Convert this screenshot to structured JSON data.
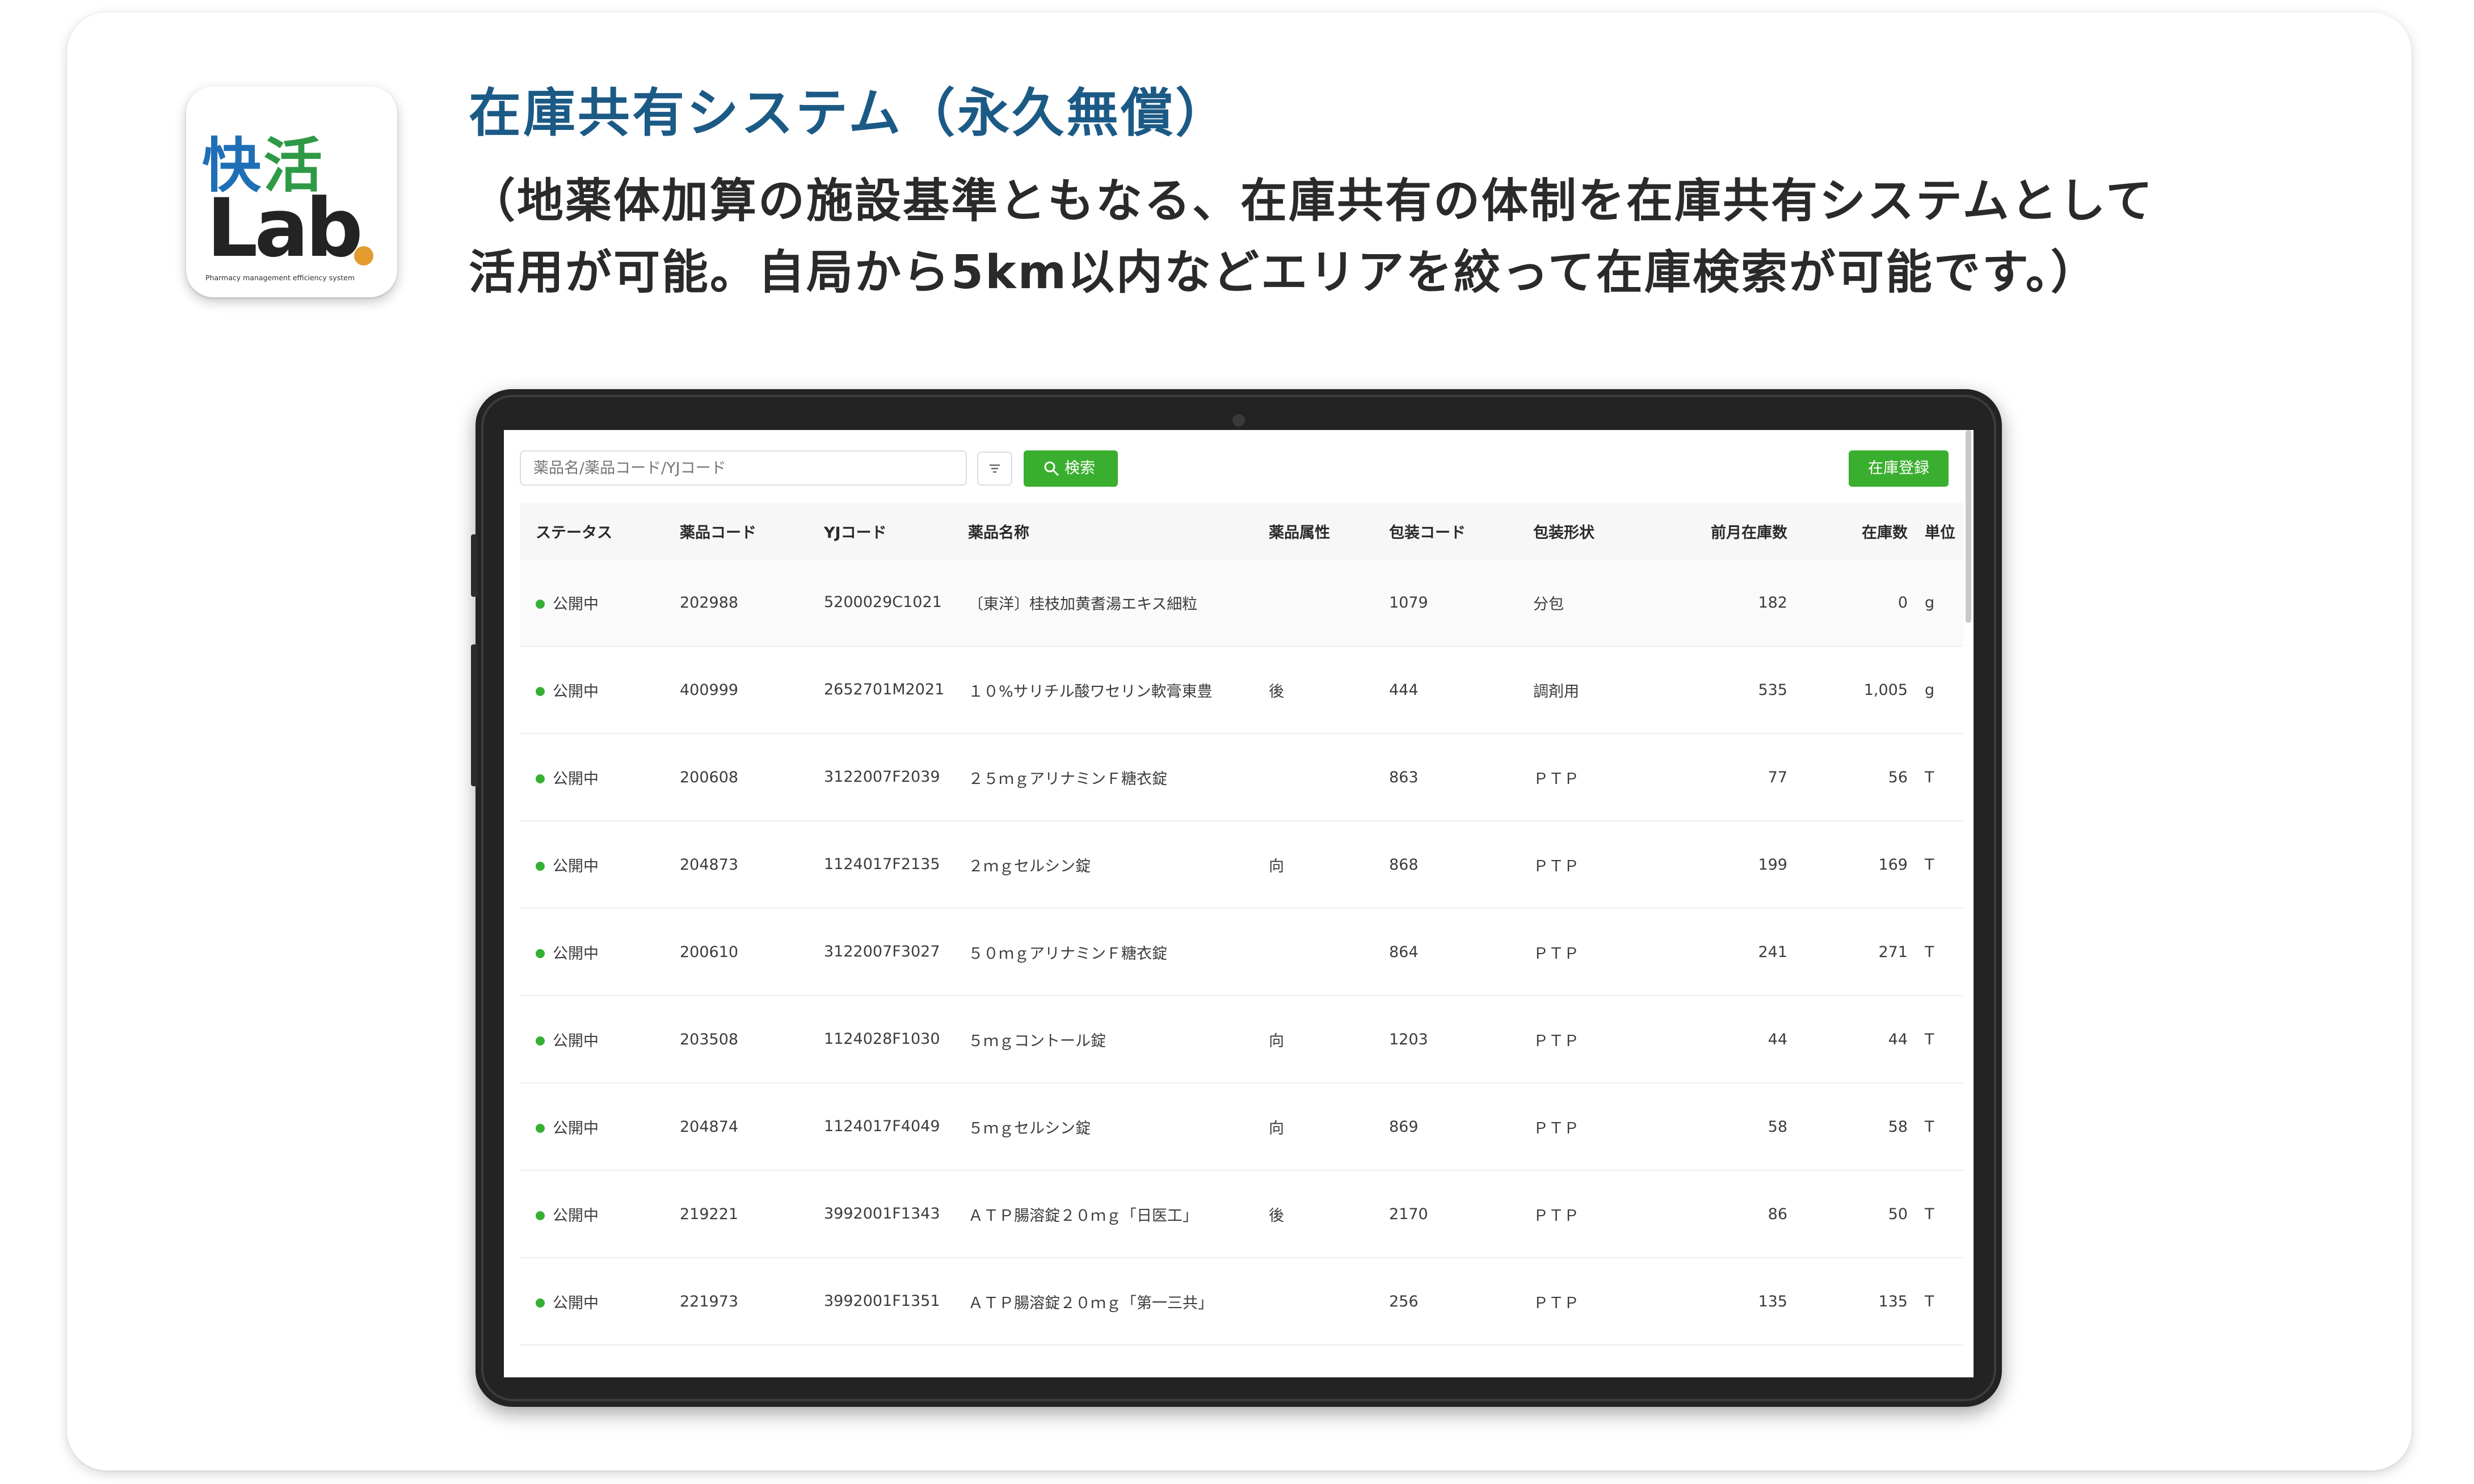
{
  "header": {
    "title": "在庫共有システム（永久無償）",
    "description_lines": [
      "（地薬体加算の施設基準ともなる、在庫共有の体制を在庫共有システムとして",
      "活用が可能。自局から5km以内などエリアを絞って在庫検索が可能です。）"
    ]
  },
  "logo": {
    "kanji1": "快",
    "kanji2": "活",
    "word": "Lab",
    "tagline": "Pharmacy management efficiency system",
    "colors": {
      "kanji1": "#1f6fb6",
      "kanji2": "#2e9a45",
      "word": "#232323",
      "dot": "#e39b2f"
    }
  },
  "toolbar": {
    "search_placeholder": "薬品名/薬品コード/YJコード",
    "filter_icon": "filter-icon",
    "search_label": "検索",
    "register_label": "在庫登録"
  },
  "colors": {
    "accent_green": "#3aaf2f",
    "status_dot": "#36b033",
    "title_blue": "#1c5a86"
  },
  "table": {
    "headers": [
      "ステータス",
      "薬品コード",
      "YJコード",
      "薬品名称",
      "薬品属性",
      "包装コード",
      "包装形状",
      "前月在庫数",
      "在庫数",
      "単位"
    ],
    "rows": [
      {
        "status": "公開中",
        "code": "202988",
        "yj": "5200029C1021",
        "name": "〔東洋〕桂枝加黄耆湯エキス細粒",
        "attr": "",
        "pack_code": "1079",
        "pack_shape": "分包",
        "prev_stock": "182",
        "stock": "0",
        "unit": "g"
      },
      {
        "status": "公開中",
        "code": "400999",
        "yj": "2652701M2021",
        "name": "１０%サリチル酸ワセリン軟膏東豊",
        "attr": "後",
        "pack_code": "444",
        "pack_shape": "調剤用",
        "prev_stock": "535",
        "stock": "1,005",
        "unit": "g"
      },
      {
        "status": "公開中",
        "code": "200608",
        "yj": "3122007F2039",
        "name": "２５ｍｇアリナミンＦ糖衣錠",
        "attr": "",
        "pack_code": "863",
        "pack_shape": "ＰＴＰ",
        "prev_stock": "77",
        "stock": "56",
        "unit": "T"
      },
      {
        "status": "公開中",
        "code": "204873",
        "yj": "1124017F2135",
        "name": "２ｍｇセルシン錠",
        "attr": "向",
        "pack_code": "868",
        "pack_shape": "ＰＴＰ",
        "prev_stock": "199",
        "stock": "169",
        "unit": "T"
      },
      {
        "status": "公開中",
        "code": "200610",
        "yj": "3122007F3027",
        "name": "５０ｍｇアリナミンＦ糖衣錠",
        "attr": "",
        "pack_code": "864",
        "pack_shape": "ＰＴＰ",
        "prev_stock": "241",
        "stock": "271",
        "unit": "T"
      },
      {
        "status": "公開中",
        "code": "203508",
        "yj": "1124028F1030",
        "name": "５ｍｇコントール錠",
        "attr": "向",
        "pack_code": "1203",
        "pack_shape": "ＰＴＰ",
        "prev_stock": "44",
        "stock": "44",
        "unit": "T"
      },
      {
        "status": "公開中",
        "code": "204874",
        "yj": "1124017F4049",
        "name": "５ｍｇセルシン錠",
        "attr": "向",
        "pack_code": "869",
        "pack_shape": "ＰＴＰ",
        "prev_stock": "58",
        "stock": "58",
        "unit": "T"
      },
      {
        "status": "公開中",
        "code": "219221",
        "yj": "3992001F1343",
        "name": "ＡＴＰ腸溶錠２０ｍｇ「日医工」",
        "attr": "後",
        "pack_code": "2170",
        "pack_shape": "ＰＴＰ",
        "prev_stock": "86",
        "stock": "50",
        "unit": "T"
      },
      {
        "status": "公開中",
        "code": "221973",
        "yj": "3992001F1351",
        "name": "ＡＴＰ腸溶錠２０ｍｇ「第一三共」",
        "attr": "",
        "pack_code": "256",
        "pack_shape": "ＰＴＰ",
        "prev_stock": "135",
        "stock": "135",
        "unit": "T"
      }
    ]
  }
}
